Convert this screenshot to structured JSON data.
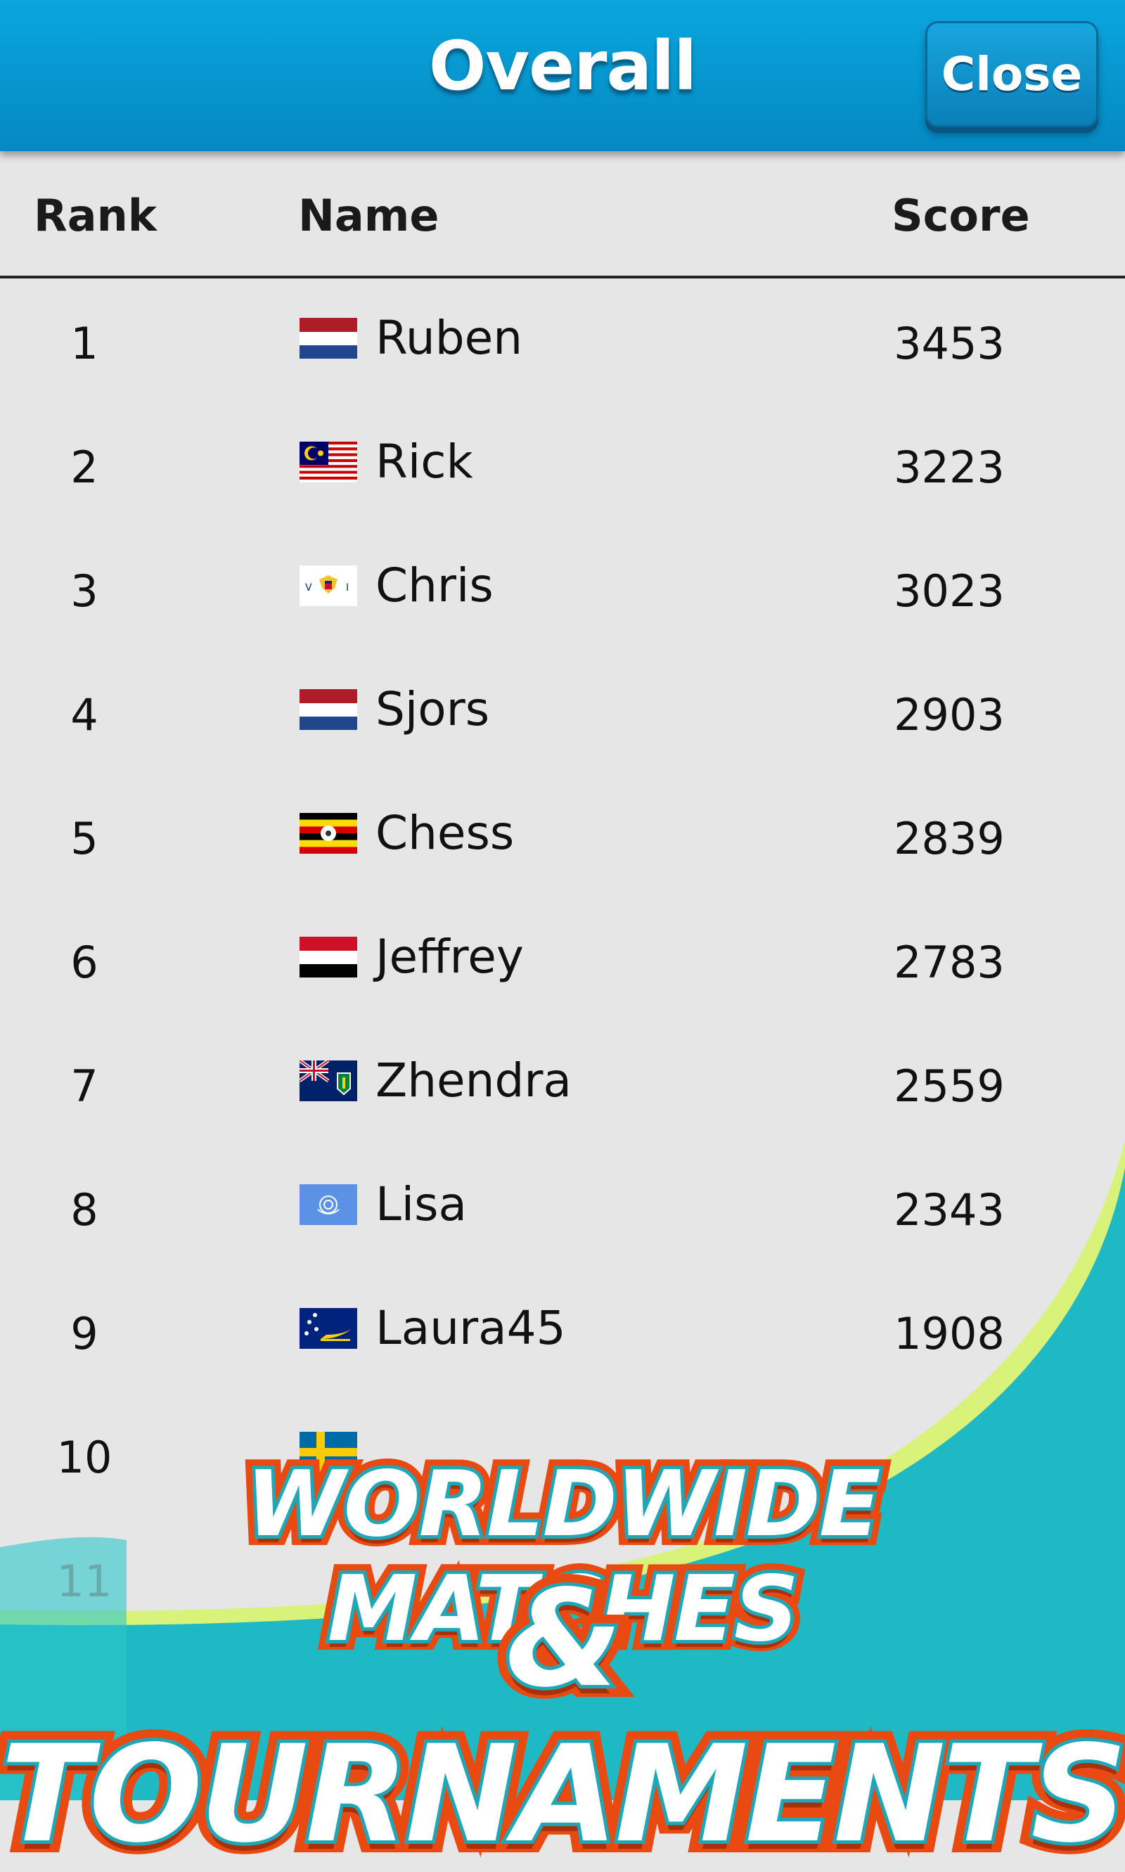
{
  "header": {
    "title": "Overall",
    "close_label": "Close"
  },
  "columns": {
    "rank": "Rank",
    "name": "Name",
    "score": "Score"
  },
  "rows": [
    {
      "rank": "1",
      "name": "Ruben",
      "score": "3453",
      "flag": "netherlands-flag-icon"
    },
    {
      "rank": "2",
      "name": "Rick",
      "score": "3223",
      "flag": "malaysia-flag-icon"
    },
    {
      "rank": "3",
      "name": "Chris",
      "score": "3023",
      "flag": "us-virgin-islands-flag-icon"
    },
    {
      "rank": "4",
      "name": "Sjors",
      "score": "2903",
      "flag": "netherlands-flag-icon"
    },
    {
      "rank": "5",
      "name": "Chess",
      "score": "2839",
      "flag": "uganda-flag-icon"
    },
    {
      "rank": "6",
      "name": "Jeffrey",
      "score": "2783",
      "flag": "yemen-flag-icon"
    },
    {
      "rank": "7",
      "name": "Zhendra",
      "score": "2559",
      "flag": "british-virgin-islands-flag-icon"
    },
    {
      "rank": "8",
      "name": "Lisa",
      "score": "2343",
      "flag": "united-nations-flag-icon"
    },
    {
      "rank": "9",
      "name": "Laura45",
      "score": "1908",
      "flag": "tokelau-flag-icon"
    },
    {
      "rank": "10",
      "name": "",
      "score": "",
      "flag": "sweden-flag-icon"
    },
    {
      "rank": "11",
      "name": "",
      "score": "",
      "flag": ""
    }
  ],
  "banner": {
    "line1": "WORLDWIDE MATCHES",
    "line2": "& TOURNAMENTS"
  },
  "colors": {
    "header_blue": "#0aa6dd",
    "teal": "#20c4c8",
    "banner_orange": "#e84a12",
    "row_bg": "#e6e6e6"
  }
}
